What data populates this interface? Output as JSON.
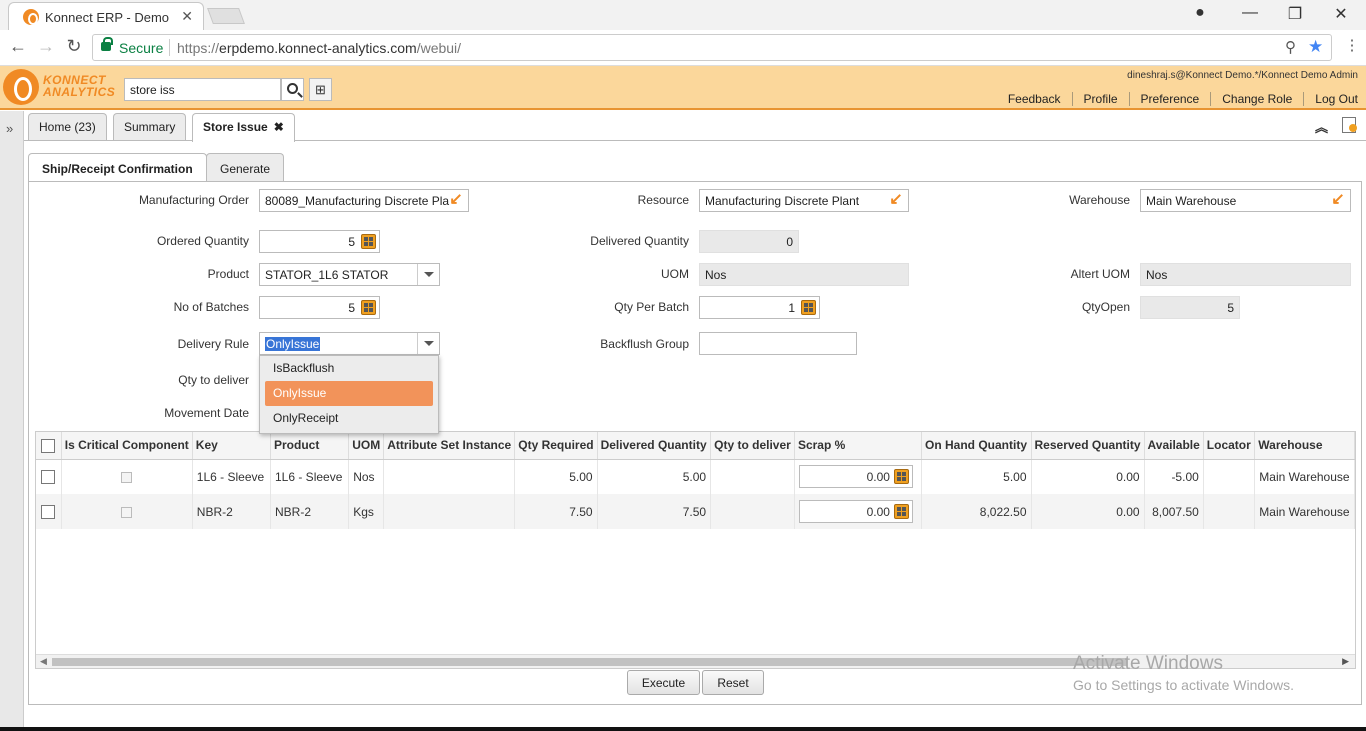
{
  "browser": {
    "tab_title": "Konnect ERP - Demo",
    "secure_label": "Secure",
    "url_scheme": "https://",
    "url_host": "erpdemo.konnect-analytics.com",
    "url_path": "/webui/"
  },
  "header": {
    "logo_line1": "KONNECT",
    "logo_line2": "ANALYTICS",
    "search_value": "store iss",
    "user_info": "dineshraj.s@Konnect Demo.*/Konnect Demo Admin",
    "links": [
      "Feedback",
      "Profile",
      "Preference",
      "Change Role",
      "Log Out"
    ],
    "brand_color": "#f08a24"
  },
  "window_tabs": [
    {
      "label": "Home (23)"
    },
    {
      "label": "Summary"
    },
    {
      "label": "Store Issue",
      "close": "✖"
    }
  ],
  "sub_tabs": [
    {
      "label": "Ship/Receipt Confirmation"
    },
    {
      "label": "Generate"
    }
  ],
  "form": {
    "manufacturing_order": {
      "label": "Manufacturing Order",
      "value": "80089_Manufacturing Discrete Pla"
    },
    "resource": {
      "label": "Resource",
      "value": "Manufacturing Discrete Plant"
    },
    "warehouse": {
      "label": "Warehouse",
      "value": "Main Warehouse"
    },
    "ordered_quantity": {
      "label": "Ordered Quantity",
      "value": "5"
    },
    "delivered_quantity": {
      "label": "Delivered Quantity",
      "value": "0"
    },
    "product": {
      "label": "Product",
      "value": "STATOR_1L6 STATOR"
    },
    "uom": {
      "label": "UOM",
      "value": "Nos"
    },
    "altert_uom": {
      "label": "Altert UOM",
      "value": "Nos"
    },
    "no_of_batches": {
      "label": "No of Batches",
      "value": "5"
    },
    "qty_per_batch": {
      "label": "Qty Per Batch",
      "value": "1"
    },
    "qty_open": {
      "label": "QtyOpen",
      "value": "5"
    },
    "delivery_rule": {
      "label": "Delivery Rule",
      "value": "OnlyIssue",
      "options": [
        "IsBackflush",
        "OnlyIssue",
        "OnlyReceipt"
      ]
    },
    "backflush_group": {
      "label": "Backflush Group",
      "value": ""
    },
    "qty_to_deliver": {
      "label": "Qty to deliver"
    },
    "movement_date": {
      "label": "Movement Date"
    }
  },
  "grid": {
    "columns": [
      "Is Critical Component",
      "Key",
      "Product",
      "UOM",
      "Attribute Set Instance",
      "Qty Required",
      "Delivered Quantity",
      "Qty to deliver",
      "Scrap %",
      "On Hand Quantity",
      "Reserved Quantity",
      "Available",
      "Locator",
      "Warehouse"
    ],
    "rows": [
      {
        "key": "1L6 - Sleeve",
        "product": "1L6 - Sleeve",
        "uom": "Nos",
        "asi": "",
        "qty_required": "5.00",
        "delivered": "5.00",
        "qty_to_deliver": "",
        "scrap": "0.00",
        "on_hand": "5.00",
        "reserved": "0.00",
        "available": "-5.00",
        "locator": "",
        "warehouse": "Main Warehouse"
      },
      {
        "key": "NBR-2",
        "product": "NBR-2",
        "uom": "Kgs",
        "asi": "",
        "qty_required": "7.50",
        "delivered": "7.50",
        "qty_to_deliver": "",
        "scrap": "0.00",
        "on_hand": "8,022.50",
        "reserved": "0.00",
        "available": "8,007.50",
        "locator": "",
        "warehouse": "Main Warehouse"
      }
    ]
  },
  "buttons": {
    "execute": "Execute",
    "reset": "Reset"
  },
  "watermark": {
    "line1": "Activate Windows",
    "line2": "Go to Settings to activate Windows."
  }
}
